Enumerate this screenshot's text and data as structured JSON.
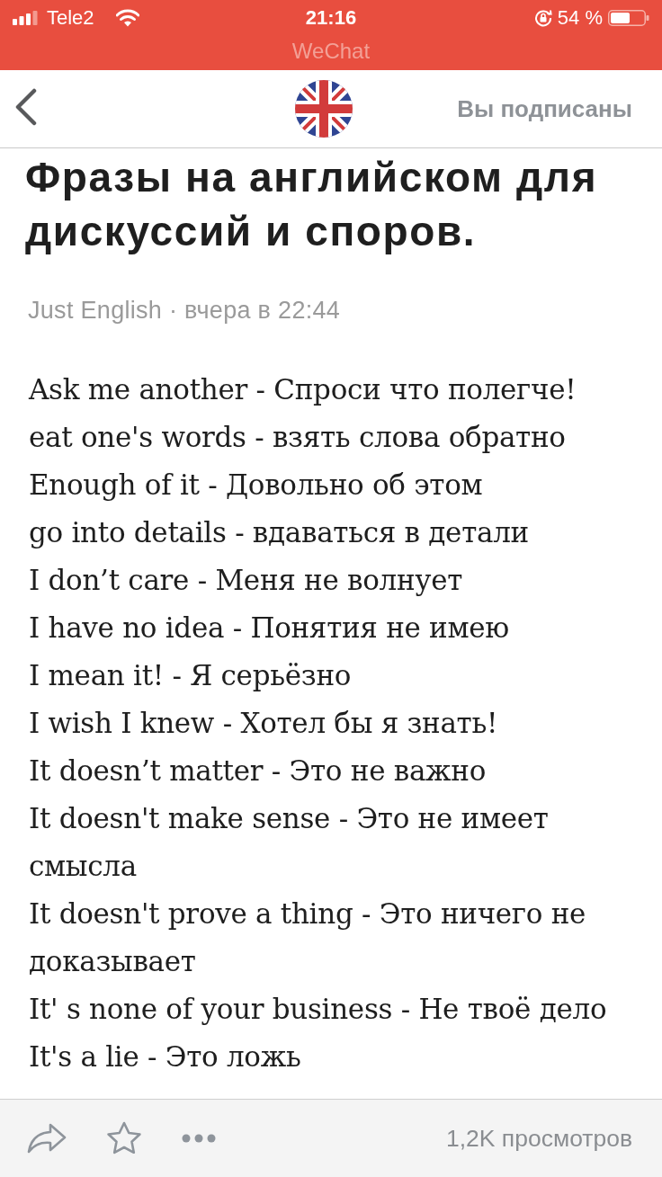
{
  "status_bar": {
    "carrier": "Tele2",
    "time": "21:16",
    "battery": "54 %",
    "app": "WeChat"
  },
  "header": {
    "subscription": "Вы подписаны"
  },
  "article": {
    "title": "Фразы на английском для дискуссий и споров.",
    "meta": "Just English · вчера в 22:44",
    "phrases": [
      "Ask me another - Спроси что полегче!",
      "eat one's words - взять слова обратно",
      "Enough of it - Довольно об этом",
      "go into details - вдаваться в детали",
      "I don’t care - Меня не волнует",
      "I have no idea - Понятия не имею",
      "I mean it! - Я серьёзно",
      "I wish I knew - Хотел бы я знать!",
      "It doesn’t matter - Это не важно",
      "It doesn't make sense - Это не имеет смысла",
      "It doesn't prove a thing - Это ничего не доказывает",
      "It' s none of your business - Не твоё дело",
      "It's a lie - Это ложь"
    ]
  },
  "bottom_bar": {
    "views": "1,2K просмотров"
  }
}
